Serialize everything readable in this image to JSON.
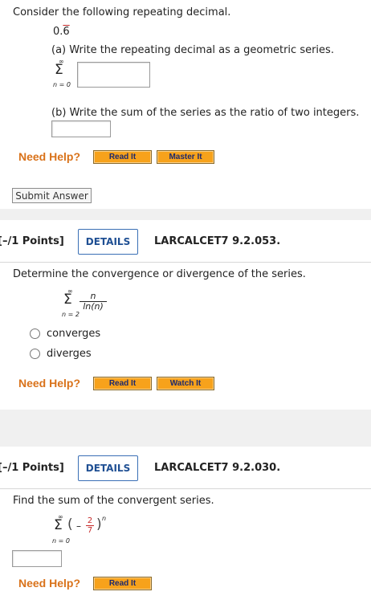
{
  "q1": {
    "prompt": "Consider the following repeating decimal.",
    "decimal_whole": "0.",
    "decimal_repeat": "6",
    "part_a": "(a) Write the repeating decimal as a geometric series.",
    "sum_upper": "∞",
    "sum_symbol": "Σ",
    "sum_lower": "n = 0",
    "part_b": "(b) Write the sum of the series as the ratio of two integers.",
    "need_help": "Need Help?",
    "read_it": "Read It",
    "master_it": "Master It",
    "submit": "Submit Answer"
  },
  "q2": {
    "points": "[–/1 Points]",
    "details": "DETAILS",
    "code": "LARCALCET7 9.2.053.",
    "prompt": "Determine the convergence or divergence of the series.",
    "sum_upper": "∞",
    "sum_symbol": "Σ",
    "sum_lower": "n = 2",
    "numerator": "n",
    "denominator": "ln(n)",
    "options": [
      "converges",
      "diverges"
    ],
    "need_help": "Need Help?",
    "read_it": "Read It",
    "watch_it": "Watch It"
  },
  "q3": {
    "points": "[–/1 Points]",
    "details": "DETAILS",
    "code": "LARCALCET7 9.2.030.",
    "prompt": "Find the sum of the convergent series.",
    "sum_upper": "∞",
    "sum_symbol": "Σ",
    "sum_lower": "n = 0",
    "open_paren": "(",
    "minus": "–",
    "frac_num": "2",
    "frac_den": "7",
    "close_paren": ")",
    "exponent": "n",
    "need_help": "Need Help?",
    "read_it": "Read It"
  },
  "colors": {
    "need_help": "#d9721a",
    "help_button": "#f7a21b",
    "details_border": "#3a6fb5",
    "fraction_red": "#c62a2a"
  }
}
